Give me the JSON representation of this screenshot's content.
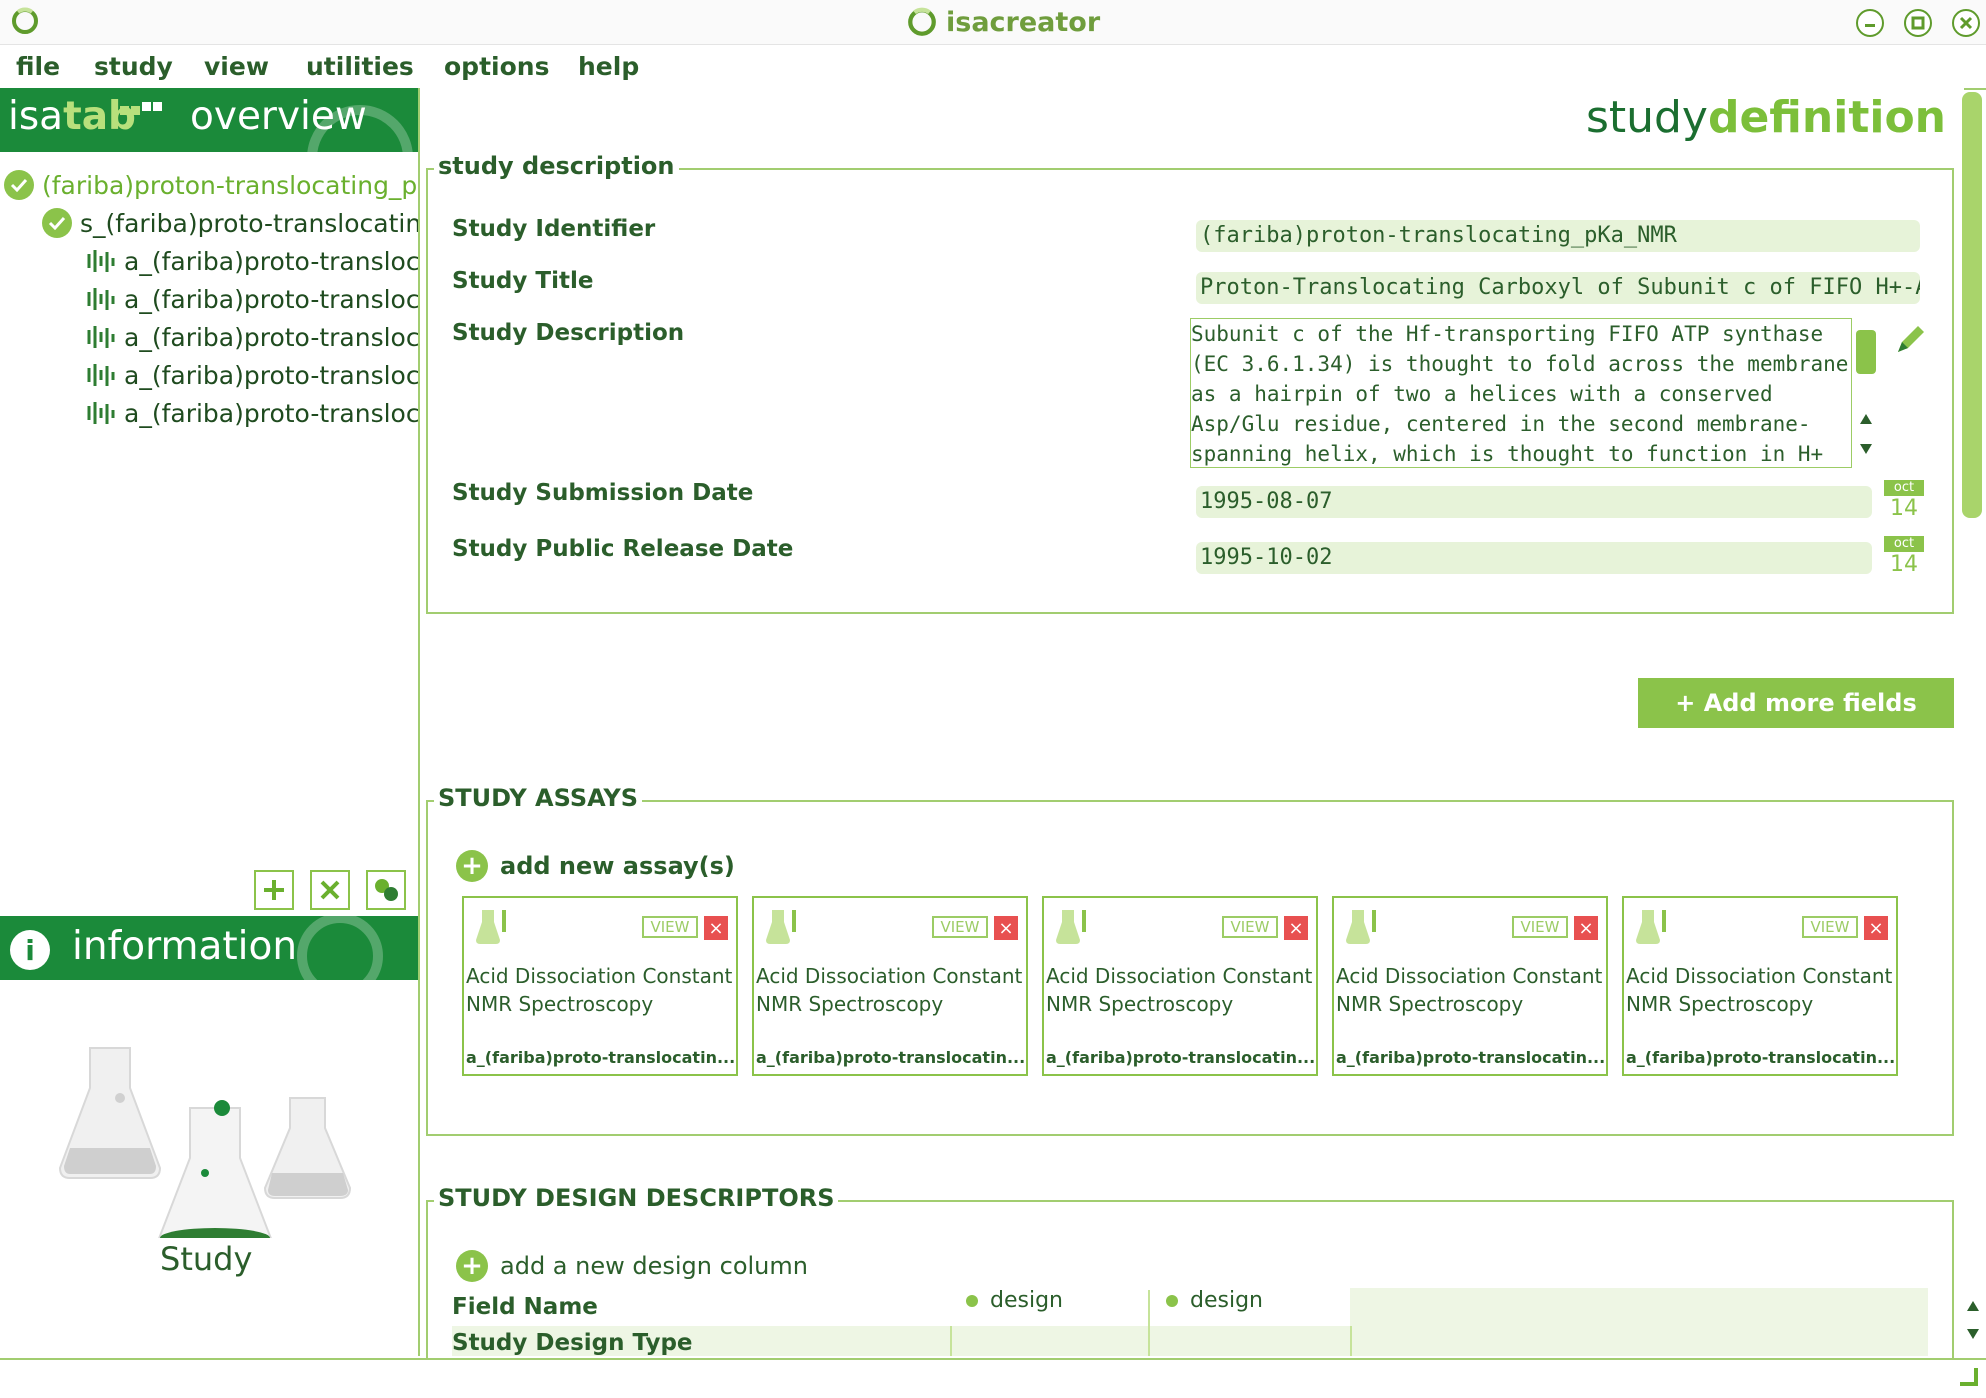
{
  "app": {
    "title": "isacreator"
  },
  "menu": [
    "file",
    "study",
    "view",
    "utilities",
    "options",
    "help"
  ],
  "overview": {
    "brand_isa": "isa",
    "brand_tab": "tab",
    "title": "overview",
    "tree": [
      {
        "label": "(fariba)proton-translocating_pKa_NMR",
        "level": 0,
        "icon": "check-icon"
      },
      {
        "label": "s_(fariba)proto-translocating",
        "level": 1,
        "icon": "check-icon"
      },
      {
        "label": "a_(fariba)proto-translocating",
        "level": 2,
        "icon": "assay-icon"
      },
      {
        "label": "a_(fariba)proto-translocating",
        "level": 2,
        "icon": "assay-icon"
      },
      {
        "label": "a_(fariba)proto-translocating",
        "level": 2,
        "icon": "assay-icon"
      },
      {
        "label": "a_(fariba)proto-translocating",
        "level": 2,
        "icon": "assay-icon"
      },
      {
        "label": "a_(fariba)proto-translocating",
        "level": 2,
        "icon": "assay-icon"
      }
    ]
  },
  "information": {
    "title": "information",
    "caption": "Study"
  },
  "heading": {
    "part1": "study",
    "part2": "definition"
  },
  "study_description": {
    "legend": "study description",
    "fields": {
      "identifier": {
        "label": "Study Identifier",
        "value": "(fariba)proton-translocating_pKa_NMR"
      },
      "title": {
        "label": "Study Title",
        "value": "Proton-Translocating Carboxyl of Subunit c of FIFO H+-ATP Synthase"
      },
      "description": {
        "label": "Study Description",
        "value": "Subunit c of the Hf-transporting FIFO ATP synthase (EC 3.6.1.34) is thought to fold across the membrane as a hairpin of two a helices with a conserved Asp/Glu residue, centered in the second membrane-spanning helix, which is thought to function in H+ translocation."
      },
      "submission_date": {
        "label": "Study Submission Date",
        "value": "1995-08-07"
      },
      "release_date": {
        "label": "Study Public Release Date",
        "value": "1995-10-02"
      }
    },
    "calendar": {
      "month": "oct",
      "day": "14"
    }
  },
  "add_more_fields": "+ Add more fields",
  "study_assays": {
    "legend": "STUDY ASSAYS",
    "add_label": "add new assay(s)",
    "cards": [
      {
        "line1": "Acid Dissociation Constant",
        "line2": "NMR Spectroscopy",
        "file": "a_(fariba)proto-translocatin...",
        "view": "VIEW"
      },
      {
        "line1": "Acid Dissociation Constant",
        "line2": "NMR Spectroscopy",
        "file": "a_(fariba)proto-translocatin...",
        "view": "VIEW"
      },
      {
        "line1": "Acid Dissociation Constant",
        "line2": "NMR Spectroscopy",
        "file": "a_(fariba)proto-translocatin...",
        "view": "VIEW"
      },
      {
        "line1": "Acid Dissociation Constant",
        "line2": "NMR Spectroscopy",
        "file": "a_(fariba)proto-translocatin...",
        "view": "VIEW"
      },
      {
        "line1": "Acid Dissociation Constant",
        "line2": "NMR Spectroscopy",
        "file": "a_(fariba)proto-translocatin...",
        "view": "VIEW"
      }
    ]
  },
  "design_descriptors": {
    "legend": "STUDY DESIGN DESCRIPTORS",
    "add_label": "add a new design column",
    "field_name": "Field Name",
    "row_label": "Study Design Type",
    "columns": [
      "design",
      "design"
    ]
  },
  "colors": {
    "primary_green": "#1b8a3a",
    "accent_green": "#8bc34a",
    "text_green": "#2b5e2b"
  }
}
